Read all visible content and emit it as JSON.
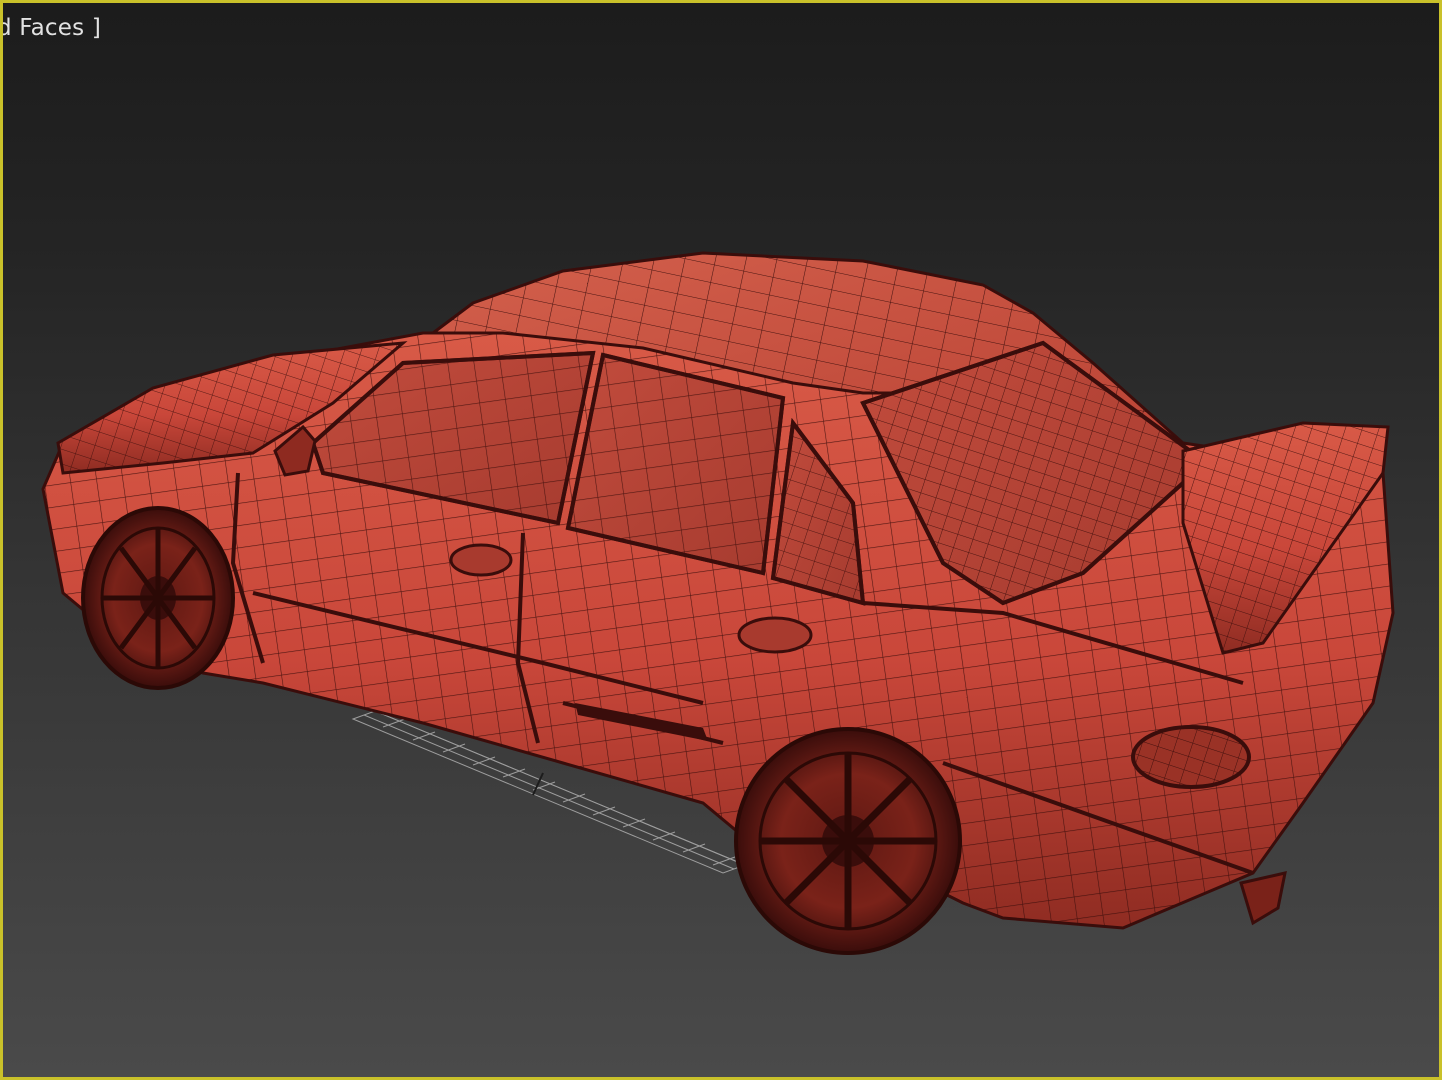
{
  "viewport": {
    "label": "d Faces ]",
    "border_color": "#c9c12a",
    "background_top": "#1c1c1c",
    "background_bottom": "#4a4a4a"
  },
  "scene": {
    "object": "car-mesh",
    "shading": "wireframe-over-shaded",
    "mesh_color": "#c9473a",
    "wire_color": "#3a0d0b",
    "grid_color": "#bdbdbd"
  }
}
